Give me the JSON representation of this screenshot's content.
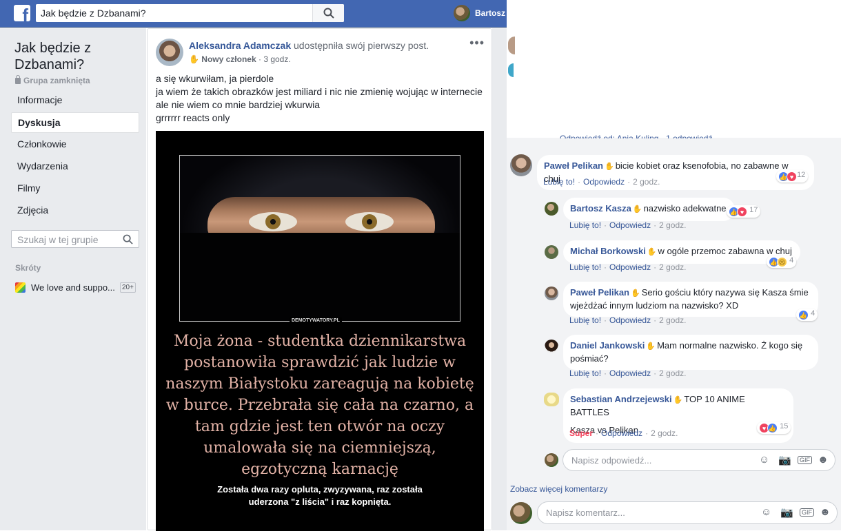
{
  "topbar": {
    "search_value": "Jak będzie z Dzbanami?",
    "user_name": "Bartosz"
  },
  "group": {
    "title_line1": "Jak będzie z",
    "title_line2": "Dzbanami?",
    "privacy": "Grupa zamknięta",
    "nav": [
      "Informacje",
      "Dyskusja",
      "Członkowie",
      "Wydarzenia",
      "Filmy",
      "Zdjęcia"
    ],
    "search_placeholder": "Szukaj w tej grupie",
    "shortcuts_title": "Skróty",
    "shortcut_label": "We love and suppo...",
    "shortcut_count": "20+"
  },
  "post": {
    "author": "Aleksandra Adamczak",
    "action": " udostępniła swój pierwszy post.",
    "badge": "Nowy członek",
    "time": "3 godz.",
    "text": [
      "a się wkurwiłam, ja pierdole",
      "ja wiem że takich obrazków jest miliard i nic nie zmienię wojując w internecie",
      "ale nie wiem co mnie bardziej wkurwia",
      "grrrrrr reacts only"
    ],
    "image_watermark": "DEMOTYWATORY.PL",
    "image_caption": [
      "Moja żona - studentka dziennikarstwa",
      "postanowiła sprawdzić jak ludzie w",
      "naszym Białystoku zareagują na kobietę",
      "w burce. Przebrała się cała na czarno, a",
      "tam gdzie jest ten otwór na oczy",
      "umalowała się na ciemniejszą,",
      "egzotyczną karnację"
    ],
    "image_subcaption": [
      "Została dwa razy opluta, zwyzywana, raz została",
      "uderzona \"z liścia\" i raz kopnięta."
    ]
  },
  "comments": {
    "hidden_reply": "Odpowiedź od: Ania Kuling · 1 odpowiedź",
    "like": "Lubię to!",
    "reply": "Odpowiedz",
    "super": "Super",
    "items": [
      {
        "name": "Paweł Pelikan",
        "text": "bicie kobiet oraz ksenofobia, no zabawne w chuj",
        "time": "2 godz.",
        "count": "12"
      },
      {
        "name": "Bartosz Kasza",
        "text": "nazwisko adekwatne",
        "time": "2 godz.",
        "count": "17"
      },
      {
        "name": "Michał Borkowski",
        "text": "w ogóle przemoc zabawna w chuj",
        "time": "2 godz.",
        "count": "4"
      },
      {
        "name": "Paweł Pelikan",
        "text1": "Serio gościu który nazywa się Kasza śmie",
        "text2": "wjeżdżać innym ludziom na nazwisko? XD",
        "time": "2 godz.",
        "count": "4"
      },
      {
        "name": "Daniel Jankowski",
        "text1": "Mam normalne nazwisko. Ż kogo się",
        "text2": "pośmiać?",
        "time": "2 godz."
      },
      {
        "name": "Sebastian Andrzejewski",
        "text1": "TOP 10 ANIME BATTLES",
        "text2": "Kasza vs Pelikan",
        "time": "2 godz.",
        "count": "15"
      }
    ],
    "reply_placeholder": "Napisz odpowiedź...",
    "more_comments": "Zobacz więcej komentarzy",
    "comment_placeholder": "Napisz komentarz..."
  }
}
